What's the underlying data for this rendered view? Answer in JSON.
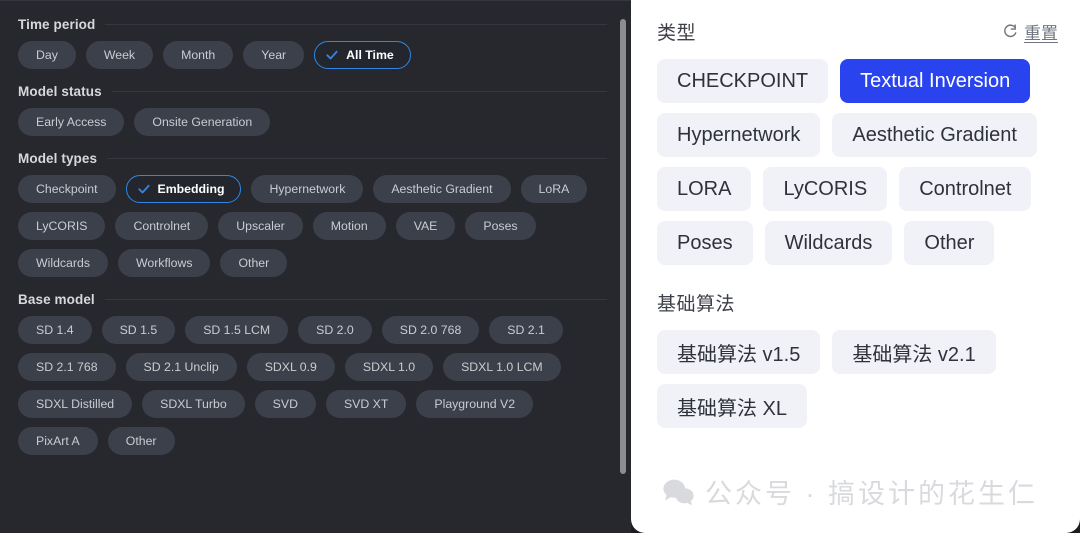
{
  "left_panel": {
    "sections": [
      {
        "title": "Time period",
        "chips": [
          {
            "label": "Day",
            "selected": false
          },
          {
            "label": "Week",
            "selected": false
          },
          {
            "label": "Month",
            "selected": false
          },
          {
            "label": "Year",
            "selected": false
          },
          {
            "label": "All Time",
            "selected": true
          }
        ]
      },
      {
        "title": "Model status",
        "chips": [
          {
            "label": "Early Access",
            "selected": false
          },
          {
            "label": "Onsite Generation",
            "selected": false
          }
        ]
      },
      {
        "title": "Model types",
        "chips": [
          {
            "label": "Checkpoint",
            "selected": false
          },
          {
            "label": "Embedding",
            "selected": true
          },
          {
            "label": "Hypernetwork",
            "selected": false
          },
          {
            "label": "Aesthetic Gradient",
            "selected": false
          },
          {
            "label": "LoRA",
            "selected": false
          },
          {
            "label": "LyCORIS",
            "selected": false
          },
          {
            "label": "Controlnet",
            "selected": false
          },
          {
            "label": "Upscaler",
            "selected": false
          },
          {
            "label": "Motion",
            "selected": false
          },
          {
            "label": "VAE",
            "selected": false
          },
          {
            "label": "Poses",
            "selected": false
          },
          {
            "label": "Wildcards",
            "selected": false
          },
          {
            "label": "Workflows",
            "selected": false
          },
          {
            "label": "Other",
            "selected": false
          }
        ]
      },
      {
        "title": "Base model",
        "chips": [
          {
            "label": "SD 1.4",
            "selected": false
          },
          {
            "label": "SD 1.5",
            "selected": false
          },
          {
            "label": "SD 1.5 LCM",
            "selected": false
          },
          {
            "label": "SD 2.0",
            "selected": false
          },
          {
            "label": "SD 2.0 768",
            "selected": false
          },
          {
            "label": "SD 2.1",
            "selected": false
          },
          {
            "label": "SD 2.1 768",
            "selected": false
          },
          {
            "label": "SD 2.1 Unclip",
            "selected": false
          },
          {
            "label": "SDXL 0.9",
            "selected": false
          },
          {
            "label": "SDXL 1.0",
            "selected": false
          },
          {
            "label": "SDXL 1.0 LCM",
            "selected": false
          },
          {
            "label": "SDXL Distilled",
            "selected": false
          },
          {
            "label": "SDXL Turbo",
            "selected": false
          },
          {
            "label": "SVD",
            "selected": false
          },
          {
            "label": "SVD XT",
            "selected": false
          },
          {
            "label": "Playground V2",
            "selected": false
          },
          {
            "label": "PixArt A",
            "selected": false
          },
          {
            "label": "Other",
            "selected": false
          }
        ]
      }
    ],
    "check_icon": "check-icon"
  },
  "right_panel": {
    "title": "类型",
    "reset_label": "重置",
    "reset_icon": "refresh-icon",
    "type_chips": [
      {
        "label": "CHECKPOINT",
        "selected": false
      },
      {
        "label": "Textual Inversion",
        "selected": true
      },
      {
        "label": "Hypernetwork",
        "selected": false
      },
      {
        "label": "Aesthetic Gradient",
        "selected": false
      },
      {
        "label": "LORA",
        "selected": false
      },
      {
        "label": "LyCORIS",
        "selected": false
      },
      {
        "label": "Controlnet",
        "selected": false
      },
      {
        "label": "Poses",
        "selected": false
      },
      {
        "label": "Wildcards",
        "selected": false
      },
      {
        "label": "Other",
        "selected": false
      }
    ],
    "base_model_title": "基础算法",
    "base_model_chips": [
      {
        "label": "基础算法 v1.5",
        "selected": false
      },
      {
        "label": "基础算法 v2.1",
        "selected": false
      },
      {
        "label": "基础算法 XL",
        "selected": false
      }
    ]
  },
  "watermark": {
    "text": "公众号 · 搞设计的花生仁",
    "icon": "wechat-icon"
  },
  "colors": {
    "left_panel_bg": "#26282e",
    "left_chip_bg": "#3b404b",
    "accent_blue": "#2f86e8",
    "right_panel_bg": "#ffffff",
    "right_chip_bg": "#f1f2f7",
    "right_accent_blue": "#2943ee"
  }
}
